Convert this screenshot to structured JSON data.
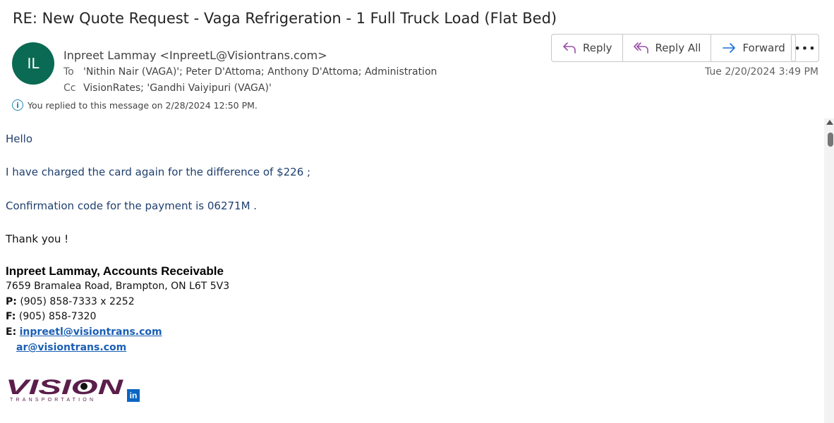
{
  "subject": "RE: New Quote Request - Vaga Refrigeration - 1 Full Truck Load (Flat Bed)",
  "avatar_initials": "IL",
  "avatar_color": "#0b6a53",
  "sender": "Inpreet Lammay <InpreetL@Visiontrans.com>",
  "to_label": "To",
  "to_value": "'Nithin Nair (VAGA)'; Peter D'Attoma; Anthony D'Attoma; Administration",
  "cc_label": "Cc",
  "cc_value": "VisionRates; 'Gandhi Vaiyipuri (VAGA)'",
  "date": "Tue 2/20/2024 3:49 PM",
  "info_text": "You replied to this message on 2/28/2024 12:50 PM.",
  "actions": {
    "reply": "Reply",
    "reply_all": "Reply All",
    "forward": "Forward",
    "more": "•••"
  },
  "body": {
    "greeting": "Hello",
    "line1": "I have charged the card again for the difference of $226 ;",
    "line2": "Confirmation code for the payment is 06271M .",
    "thanks": "Thank you !"
  },
  "signature": {
    "name": "Inpreet Lammay, Accounts Receivable",
    "address": "7659 Bramalea Road, Brampton, ON  L6T 5V3",
    "phone_label": "P:",
    "phone": "(905) 858-7333 x 2252",
    "fax_label": "F:",
    "fax": "(905) 858-7320",
    "email_label": "E:",
    "email1": "inpreetl@visiontrans.com",
    "email2": "ar@visiontrans.com",
    "logo_text": "VISION",
    "logo_subtext": "TRANSPORTATION",
    "linkedin": "in"
  }
}
